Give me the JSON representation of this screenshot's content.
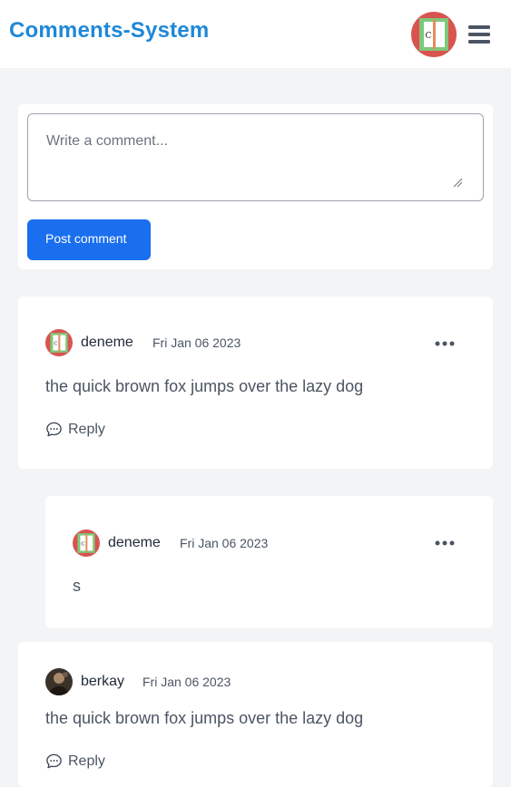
{
  "header": {
    "brand": "Comments-System",
    "avatar_icon": "user-avatar",
    "menu_icon": "hamburger-menu-icon"
  },
  "composer": {
    "placeholder": "Write a comment...",
    "post_label": "Post comment"
  },
  "comments": [
    {
      "username": "deneme",
      "date": "Fri Jan 06 2023",
      "text": "the quick brown fox jumps over the lazy dog",
      "reply_label": "Reply"
    },
    {
      "username": "deneme",
      "date": "Fri Jan 06 2023",
      "text": "s"
    },
    {
      "username": "berkay",
      "date": "Fri Jan 06 2023",
      "text": "the quick brown fox jumps over the lazy dog",
      "reply_label": "Reply"
    }
  ],
  "colors": {
    "brand": "#1e88d8",
    "button": "#1a6fee",
    "background": "#f3f4f6"
  }
}
